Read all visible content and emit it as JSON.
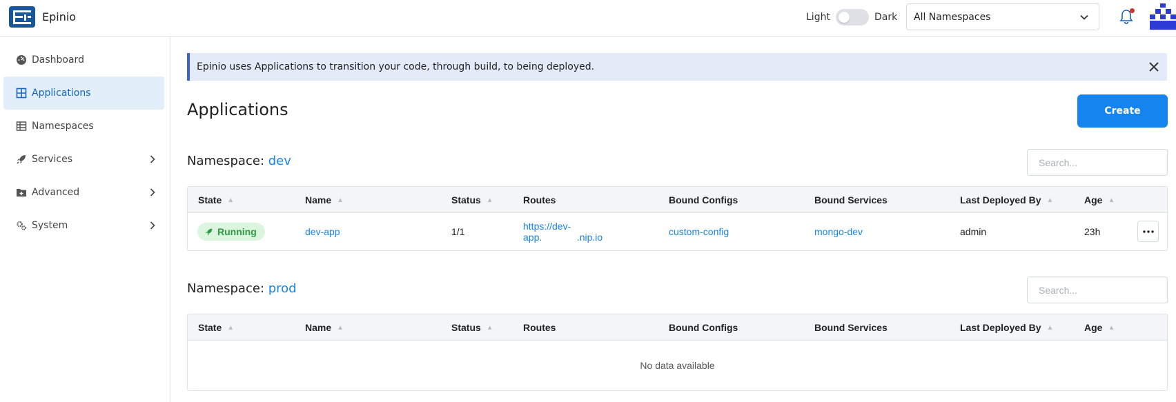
{
  "brand": {
    "name": "Epinio"
  },
  "header": {
    "theme_light": "Light",
    "theme_dark": "Dark",
    "namespace_selected": "All Namespaces"
  },
  "sidebar": {
    "items": [
      {
        "label": "Dashboard",
        "icon": "dashboard-icon"
      },
      {
        "label": "Applications",
        "icon": "grid-icon",
        "active": true
      },
      {
        "label": "Namespaces",
        "icon": "table-icon"
      },
      {
        "label": "Services",
        "icon": "rocket-icon",
        "expandable": true
      },
      {
        "label": "Advanced",
        "icon": "folder-plus-icon",
        "expandable": true
      },
      {
        "label": "System",
        "icon": "gears-icon",
        "expandable": true
      }
    ]
  },
  "banner": {
    "text": "Epinio uses Applications to transition your code, through build, to being deployed."
  },
  "page": {
    "title": "Applications",
    "create_label": "Create"
  },
  "columns": [
    "State",
    "Name",
    "Status",
    "Routes",
    "Bound Configs",
    "Bound Services",
    "Last Deployed By",
    "Age"
  ],
  "sections": [
    {
      "label": "Namespace:",
      "namespace": "dev",
      "search_placeholder": "Search...",
      "rows": [
        {
          "state": "Running",
          "name": "dev-app",
          "status": "1/1",
          "route_line1": "https://dev-",
          "route_line2": "app.             .nip.io",
          "bound_configs": "custom-config",
          "bound_services": "mongo-dev",
          "last_deployed_by": "admin",
          "age": "23h"
        }
      ]
    },
    {
      "label": "Namespace:",
      "namespace": "prod",
      "search_placeholder": "Search...",
      "rows": [],
      "empty_text": "No data available"
    }
  ],
  "colors": {
    "accent": "#1584ef",
    "running_bg": "#dbf5de",
    "running_text": "#2f9a44",
    "banner_bg": "#e3eaf8",
    "banner_border": "#3d63c8"
  }
}
